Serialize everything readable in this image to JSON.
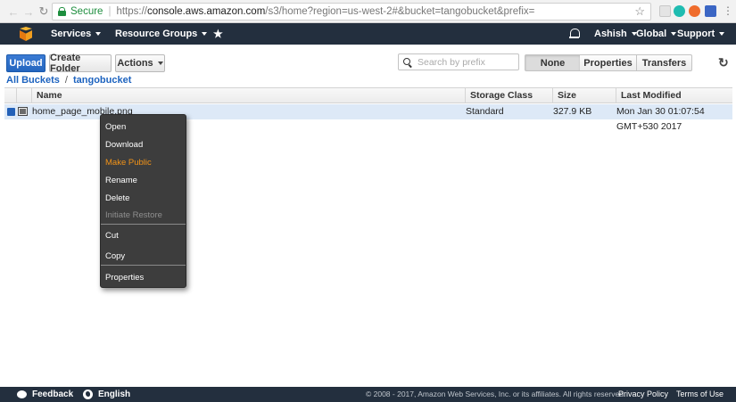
{
  "browser": {
    "secure_label": "Secure",
    "url_scheme": "https://",
    "url_host": "console.aws.amazon.com",
    "url_rest": "/s3/home?region=us-west-2#&bucket=tangobucket&prefix="
  },
  "topnav": {
    "services": "Services",
    "resource_groups": "Resource Groups",
    "user": "Ashish",
    "region": "Global",
    "support": "Support"
  },
  "toolbar": {
    "upload": "Upload",
    "create_folder": "Create Folder",
    "actions": "Actions",
    "search_placeholder": "Search by prefix",
    "tabs": [
      "None",
      "Properties",
      "Transfers"
    ]
  },
  "breadcrumb": {
    "root": "All Buckets",
    "separator": "/",
    "bucket": "tangobucket"
  },
  "table": {
    "headers": {
      "name": "Name",
      "storage_class": "Storage Class",
      "size": "Size",
      "last_modified": "Last Modified"
    },
    "rows": [
      {
        "name": "home_page_mobile.png",
        "storage_class": "Standard",
        "size": "327.9 KB",
        "last_modified": "Mon Jan 30 01:07:54 GMT+530 2017"
      }
    ]
  },
  "context_menu": {
    "open": "Open",
    "download": "Download",
    "make_public": "Make Public",
    "rename": "Rename",
    "delete": "Delete",
    "initiate_restore": "Initiate Restore",
    "cut": "Cut",
    "copy": "Copy",
    "properties": "Properties"
  },
  "footer": {
    "feedback": "Feedback",
    "language": "English",
    "copyright": "© 2008 - 2017, Amazon Web Services, Inc. or its affiliates. All rights reserved.",
    "privacy": "Privacy Policy",
    "terms": "Terms of Use"
  },
  "colors": {
    "aws_nav_bg": "#232f3e",
    "primary_button": "#2466bf",
    "link": "#1d63bf",
    "selected_row": "#dde9f7",
    "menu_highlight": "#f29318"
  }
}
